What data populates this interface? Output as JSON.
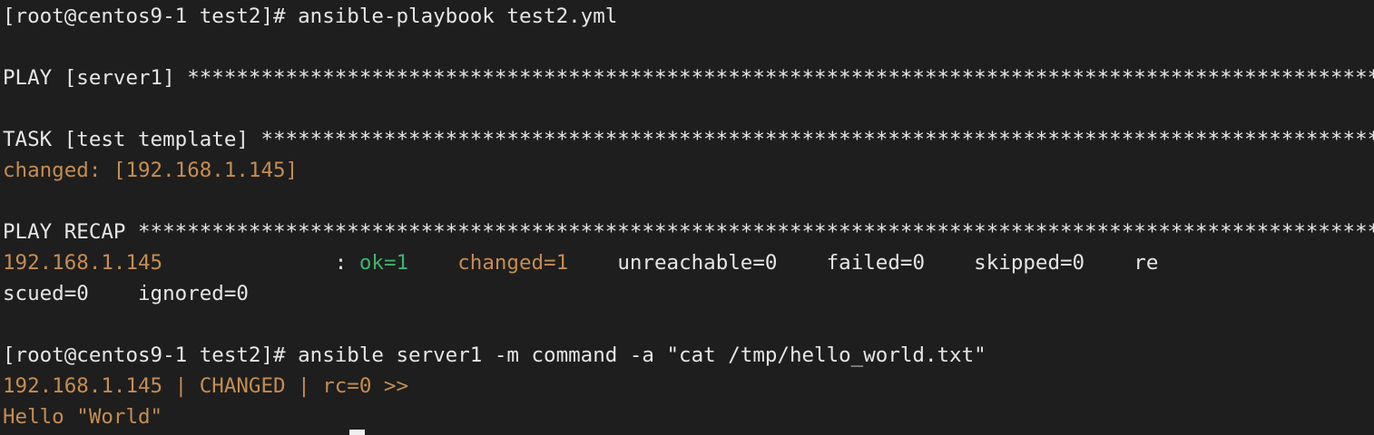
{
  "terminal": {
    "lines": [
      {
        "segs": [
          {
            "text": "[root@centos9-1 test2]# ansible-playbook test2.yml",
            "color": "#e6e6e6"
          }
        ]
      },
      {
        "segs": [
          {
            "text": "",
            "color": "#e6e6e6"
          }
        ]
      },
      {
        "segs": [
          {
            "text": "PLAY [server1] *************************************************************************************************",
            "color": "#e6e6e6"
          }
        ]
      },
      {
        "segs": [
          {
            "text": "",
            "color": "#e6e6e6"
          }
        ]
      },
      {
        "segs": [
          {
            "text": "TASK [test template] *******************************************************************************************",
            "color": "#e6e6e6"
          }
        ]
      },
      {
        "segs": [
          {
            "text": "changed: [192.168.1.145]",
            "color": "#c58d52"
          }
        ]
      },
      {
        "segs": [
          {
            "text": "",
            "color": "#e6e6e6"
          }
        ]
      },
      {
        "segs": [
          {
            "text": "PLAY RECAP *****************************************************************************************************",
            "color": "#e6e6e6"
          }
        ]
      },
      {
        "segs": [
          {
            "text": "192.168.1.145",
            "color": "#c58d52"
          },
          {
            "text": "              : ",
            "color": "#e6e6e6"
          },
          {
            "text": "ok=1",
            "color": "#3fb26d"
          },
          {
            "text": "    ",
            "color": "#e6e6e6"
          },
          {
            "text": "changed=1",
            "color": "#c58d52"
          },
          {
            "text": "    unreachable=0    failed=0    skipped=0    re",
            "color": "#e6e6e6"
          }
        ]
      },
      {
        "segs": [
          {
            "text": "scued=0    ignored=0",
            "color": "#e6e6e6"
          }
        ]
      },
      {
        "segs": [
          {
            "text": "",
            "color": "#e6e6e6"
          }
        ]
      },
      {
        "segs": [
          {
            "text": "[root@centos9-1 test2]# ansible server1 -m command -a \"cat /tmp/hello_world.txt\"",
            "color": "#e6e6e6"
          }
        ]
      },
      {
        "segs": [
          {
            "text": "192.168.1.145 | CHANGED | rc=0 >>",
            "color": "#c58d52"
          }
        ]
      },
      {
        "segs": [
          {
            "text": "Hello \"World\"",
            "color": "#c58d52"
          }
        ]
      }
    ]
  }
}
